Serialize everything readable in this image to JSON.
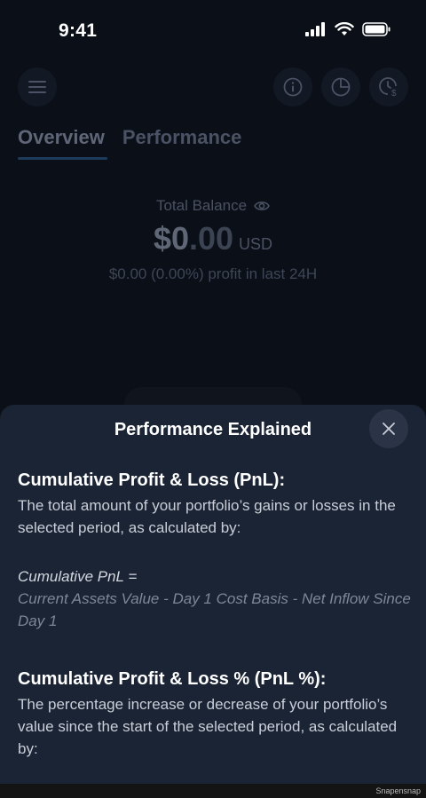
{
  "status_bar": {
    "time": "9:41",
    "icons": [
      "signal-icon",
      "wifi-icon",
      "battery-icon"
    ]
  },
  "header": {
    "icons": [
      "menu-icon",
      "info-icon",
      "pie-chart-icon",
      "clock-dollar-icon"
    ]
  },
  "tabs": [
    {
      "label": "Overview",
      "active": true
    },
    {
      "label": "Performance",
      "active": false
    }
  ],
  "balance": {
    "label": "Total Balance",
    "value_int": "$0",
    "value_dec": ".00",
    "currency": "USD",
    "profit_text": "$0.00 (0.00%) profit in last 24H"
  },
  "sheet": {
    "title": "Performance Explained",
    "sections": [
      {
        "title": "Cumulative Profit & Loss (PnL):",
        "description": "The total amount of your portfolio’s gains or losses in the selected period, as calculated by:",
        "formula_name": "Cumulative PnL =",
        "formula_expr": "Current Assets Value - Day 1 Cost Basis - Net Inflow Since Day 1"
      },
      {
        "title": "Cumulative Profit & Loss % (PnL %):",
        "description": "The percentage increase or decrease of your portfolio’s value since the start of the selected period, as calculated by:"
      }
    ]
  },
  "footer": {
    "watermark": "Snapensnap"
  },
  "colors": {
    "background": "#0b0f17",
    "sheet": "#1b2434",
    "close_button": "#2a3446",
    "tab_underline": "#1e3b5c"
  }
}
